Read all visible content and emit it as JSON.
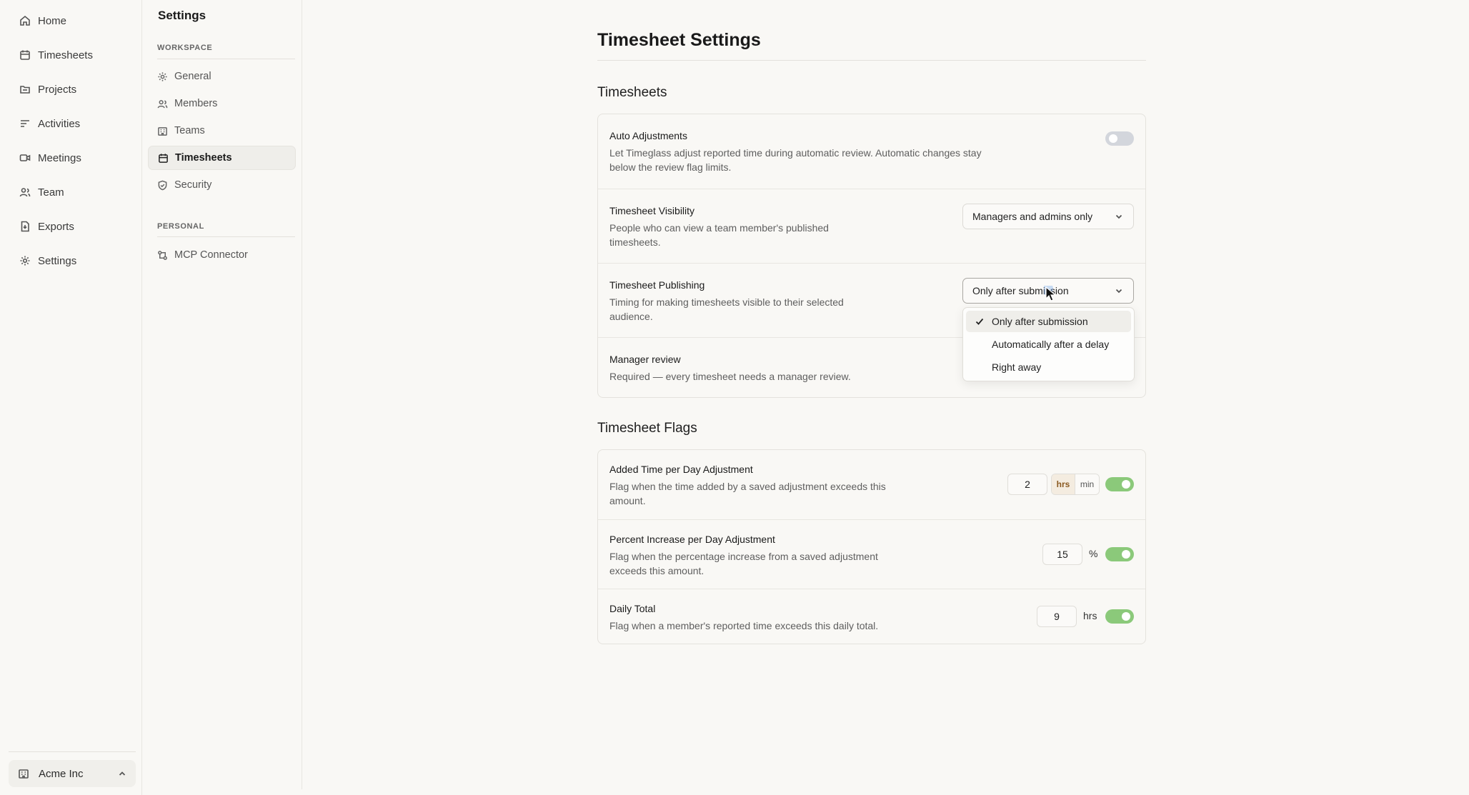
{
  "nav": {
    "items": [
      {
        "label": "Home",
        "icon": "home-icon"
      },
      {
        "label": "Timesheets",
        "icon": "calendar-icon"
      },
      {
        "label": "Projects",
        "icon": "folder-icon"
      },
      {
        "label": "Activities",
        "icon": "list-icon"
      },
      {
        "label": "Meetings",
        "icon": "video-icon"
      },
      {
        "label": "Team",
        "icon": "users-icon"
      },
      {
        "label": "Exports",
        "icon": "file-icon"
      },
      {
        "label": "Settings",
        "icon": "gear-icon"
      }
    ],
    "workspace": "Acme Inc"
  },
  "subnav": {
    "title": "Settings",
    "workspace_heading": "WORKSPACE",
    "workspace_items": [
      {
        "label": "General",
        "icon": "gear-icon"
      },
      {
        "label": "Members",
        "icon": "users-icon"
      },
      {
        "label": "Teams",
        "icon": "building-icon"
      },
      {
        "label": "Timesheets",
        "icon": "calendar-icon",
        "active": true
      },
      {
        "label": "Security",
        "icon": "shield-icon"
      }
    ],
    "personal_heading": "PERSONAL",
    "personal_items": [
      {
        "label": "MCP Connector",
        "icon": "connector-icon"
      }
    ]
  },
  "main": {
    "title": "Timesheet Settings",
    "timesheets": {
      "heading": "Timesheets",
      "auto_adjustments": {
        "label": "Auto Adjustments",
        "desc_line1": "Let Timeglass adjust reported time during automatic review. Automatic changes stay",
        "desc_line2": "below the review flag limits.",
        "enabled": false
      },
      "visibility": {
        "label": "Timesheet Visibility",
        "desc_line1": "People who can view a team member's published",
        "desc_line2": "timesheets.",
        "value": "Managers and admins only"
      },
      "publishing": {
        "label": "Timesheet Publishing",
        "desc_line1": "Timing for making timesheets visible to their selected",
        "desc_line2": "audience.",
        "value": "Only after submission",
        "options": [
          "Only after submission",
          "Automatically after a delay",
          "Right away"
        ]
      },
      "manager_review": {
        "label": "Manager review",
        "desc": "Required — every timesheet needs a manager review."
      }
    },
    "flags": {
      "heading": "Timesheet Flags",
      "added_time": {
        "label": "Added Time per Day Adjustment",
        "desc_line1": "Flag when the time added by a saved adjustment exceeds this",
        "desc_line2": "amount.",
        "value": "2",
        "unit_hrs": "hrs",
        "unit_min": "min",
        "enabled": true
      },
      "percent_increase": {
        "label": "Percent Increase per Day Adjustment",
        "desc_line1": "Flag when the percentage increase from a saved adjustment",
        "desc_line2": "exceeds this amount.",
        "value": "15",
        "unit": "%",
        "enabled": true
      },
      "daily_total": {
        "label": "Daily Total",
        "desc": "Flag when a member's reported time exceeds this daily total.",
        "value": "9",
        "unit": "hrs",
        "enabled": true
      }
    }
  }
}
